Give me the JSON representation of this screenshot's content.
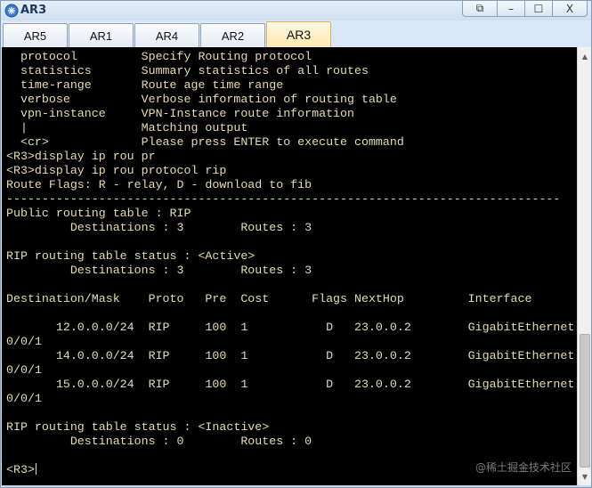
{
  "window": {
    "title": "AR3",
    "controls": {
      "restore": "⧉",
      "minimize": "–",
      "maximize": "☐",
      "close": "X"
    }
  },
  "tabs": [
    {
      "label": "AR5",
      "active": false
    },
    {
      "label": "AR1",
      "active": false
    },
    {
      "label": "AR4",
      "active": false
    },
    {
      "label": "AR2",
      "active": false
    },
    {
      "label": "AR3",
      "active": true
    }
  ],
  "terminal": {
    "lines": [
      "  protocol         Specify Routing protocol",
      "  statistics       Summary statistics of all routes",
      "  time-range       Route age time range",
      "  verbose          Verbose information of routing table",
      "  vpn-instance     VPN-Instance route information",
      "  |                Matching output",
      "  <cr>             Please press ENTER to execute command",
      "<R3>display ip rou pr",
      "<R3>display ip rou protocol rip",
      "Route Flags: R - relay, D - download to fib",
      "------------------------------------------------------------------------------",
      "Public routing table : RIP",
      "         Destinations : 3        Routes : 3",
      "",
      "RIP routing table status : <Active>",
      "         Destinations : 3        Routes : 3",
      "",
      "Destination/Mask    Proto   Pre  Cost      Flags NextHop         Interface",
      "",
      "       12.0.0.0/24  RIP     100  1           D   23.0.0.2        GigabitEthernet",
      "0/0/1",
      "       14.0.0.0/24  RIP     100  1           D   23.0.0.2        GigabitEthernet",
      "0/0/1",
      "       15.0.0.0/24  RIP     100  1           D   23.0.0.2        GigabitEthernet",
      "0/0/1",
      "",
      "RIP routing table status : <Inactive>",
      "         Destinations : 0        Routes : 0",
      "",
      "<R3>"
    ]
  },
  "watermark": "@稀土掘金技术社区",
  "colors": {
    "terminal_bg": "#000000",
    "terminal_fg": "#e8dcb0",
    "active_tab": "#ffe8b0"
  }
}
